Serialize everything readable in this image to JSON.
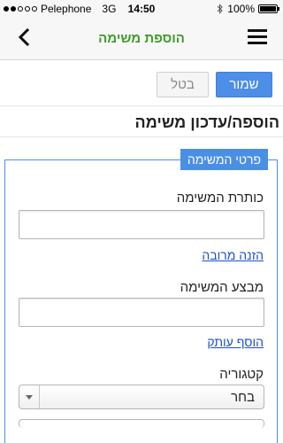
{
  "status_bar": {
    "carrier": "Pelephone",
    "network": "3G",
    "time": "14:50",
    "battery": "100%",
    "battery_level": 1.0,
    "signal_bars_filled": 2,
    "signal_bars_total": 5,
    "icons": [
      "signal-icon",
      "bluetooth-icon",
      "battery-icon"
    ]
  },
  "nav": {
    "title": "הוספת משימה",
    "back_icon": "chevron-left-icon",
    "menu_icon": "hamburger-menu-icon",
    "title_color": "#3f9b2b"
  },
  "toolbar": {
    "save_label": "שמור",
    "cancel_label": "בטל",
    "save_color": "#4d8ee8"
  },
  "page": {
    "heading": "הוספה/עדכון משימה"
  },
  "form": {
    "legend": "פרטי המשימה",
    "title_label": "כותרת המשימה",
    "title_value": "",
    "bulk_entry_link": "הזנה מרובה",
    "assignee_label": "מבצע המשימה",
    "assignee_value": "",
    "add_copy_link": "הוסף עותק",
    "category_label": "קטגוריה",
    "category_selected": "בחר",
    "accent_color": "#4a8fe3"
  }
}
